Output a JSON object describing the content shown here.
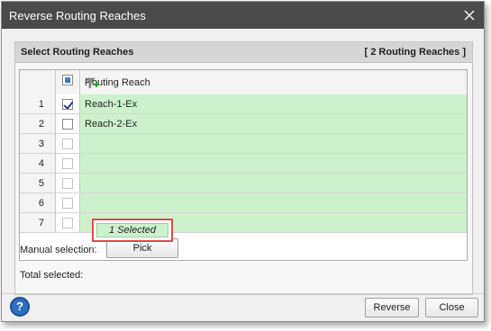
{
  "window": {
    "title": "Reverse Routing Reaches",
    "close_icon": "close-icon"
  },
  "panel": {
    "title": "Select Routing Reaches",
    "count_label": "[ 2 Routing Reaches ]"
  },
  "grid": {
    "column_header": "Routing Reach",
    "filter_icon": "filter-add-icon",
    "rows": [
      {
        "num": "1",
        "checked": true,
        "reach": "Reach-1-Ex"
      },
      {
        "num": "2",
        "checked": false,
        "reach": "Reach-2-Ex"
      },
      {
        "num": "3",
        "checked": false,
        "reach": ""
      },
      {
        "num": "4",
        "checked": false,
        "reach": ""
      },
      {
        "num": "5",
        "checked": false,
        "reach": ""
      },
      {
        "num": "6",
        "checked": false,
        "reach": ""
      },
      {
        "num": "7",
        "checked": false,
        "reach": ""
      }
    ]
  },
  "manual_selection": {
    "label": "Manual selection:",
    "pick_label": "Pick"
  },
  "total_selected": {
    "label": "Total selected:",
    "value": "1 Selected"
  },
  "footer": {
    "help_icon": "help-icon",
    "reverse_label": "Reverse",
    "close_label": "Close"
  },
  "colors": {
    "titlebar": "#4a4a4a",
    "row_green": "#ccf2cc",
    "highlight_red": "#e04a4a",
    "help_blue": "#2f6fc0"
  }
}
